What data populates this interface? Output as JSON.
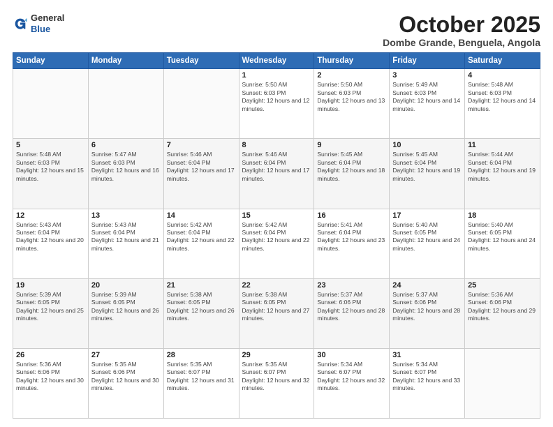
{
  "header": {
    "logo": {
      "line1": "General",
      "line2": "Blue"
    },
    "title": "October 2025",
    "subtitle": "Dombe Grande, Benguela, Angola"
  },
  "weekdays": [
    "Sunday",
    "Monday",
    "Tuesday",
    "Wednesday",
    "Thursday",
    "Friday",
    "Saturday"
  ],
  "weeks": [
    [
      {
        "day": "",
        "sunrise": "",
        "sunset": "",
        "daylight": ""
      },
      {
        "day": "",
        "sunrise": "",
        "sunset": "",
        "daylight": ""
      },
      {
        "day": "",
        "sunrise": "",
        "sunset": "",
        "daylight": ""
      },
      {
        "day": "1",
        "sunrise": "Sunrise: 5:50 AM",
        "sunset": "Sunset: 6:03 PM",
        "daylight": "Daylight: 12 hours and 12 minutes."
      },
      {
        "day": "2",
        "sunrise": "Sunrise: 5:50 AM",
        "sunset": "Sunset: 6:03 PM",
        "daylight": "Daylight: 12 hours and 13 minutes."
      },
      {
        "day": "3",
        "sunrise": "Sunrise: 5:49 AM",
        "sunset": "Sunset: 6:03 PM",
        "daylight": "Daylight: 12 hours and 14 minutes."
      },
      {
        "day": "4",
        "sunrise": "Sunrise: 5:48 AM",
        "sunset": "Sunset: 6:03 PM",
        "daylight": "Daylight: 12 hours and 14 minutes."
      }
    ],
    [
      {
        "day": "5",
        "sunrise": "Sunrise: 5:48 AM",
        "sunset": "Sunset: 6:03 PM",
        "daylight": "Daylight: 12 hours and 15 minutes."
      },
      {
        "day": "6",
        "sunrise": "Sunrise: 5:47 AM",
        "sunset": "Sunset: 6:03 PM",
        "daylight": "Daylight: 12 hours and 16 minutes."
      },
      {
        "day": "7",
        "sunrise": "Sunrise: 5:46 AM",
        "sunset": "Sunset: 6:04 PM",
        "daylight": "Daylight: 12 hours and 17 minutes."
      },
      {
        "day": "8",
        "sunrise": "Sunrise: 5:46 AM",
        "sunset": "Sunset: 6:04 PM",
        "daylight": "Daylight: 12 hours and 17 minutes."
      },
      {
        "day": "9",
        "sunrise": "Sunrise: 5:45 AM",
        "sunset": "Sunset: 6:04 PM",
        "daylight": "Daylight: 12 hours and 18 minutes."
      },
      {
        "day": "10",
        "sunrise": "Sunrise: 5:45 AM",
        "sunset": "Sunset: 6:04 PM",
        "daylight": "Daylight: 12 hours and 19 minutes."
      },
      {
        "day": "11",
        "sunrise": "Sunrise: 5:44 AM",
        "sunset": "Sunset: 6:04 PM",
        "daylight": "Daylight: 12 hours and 19 minutes."
      }
    ],
    [
      {
        "day": "12",
        "sunrise": "Sunrise: 5:43 AM",
        "sunset": "Sunset: 6:04 PM",
        "daylight": "Daylight: 12 hours and 20 minutes."
      },
      {
        "day": "13",
        "sunrise": "Sunrise: 5:43 AM",
        "sunset": "Sunset: 6:04 PM",
        "daylight": "Daylight: 12 hours and 21 minutes."
      },
      {
        "day": "14",
        "sunrise": "Sunrise: 5:42 AM",
        "sunset": "Sunset: 6:04 PM",
        "daylight": "Daylight: 12 hours and 22 minutes."
      },
      {
        "day": "15",
        "sunrise": "Sunrise: 5:42 AM",
        "sunset": "Sunset: 6:04 PM",
        "daylight": "Daylight: 12 hours and 22 minutes."
      },
      {
        "day": "16",
        "sunrise": "Sunrise: 5:41 AM",
        "sunset": "Sunset: 6:04 PM",
        "daylight": "Daylight: 12 hours and 23 minutes."
      },
      {
        "day": "17",
        "sunrise": "Sunrise: 5:40 AM",
        "sunset": "Sunset: 6:05 PM",
        "daylight": "Daylight: 12 hours and 24 minutes."
      },
      {
        "day": "18",
        "sunrise": "Sunrise: 5:40 AM",
        "sunset": "Sunset: 6:05 PM",
        "daylight": "Daylight: 12 hours and 24 minutes."
      }
    ],
    [
      {
        "day": "19",
        "sunrise": "Sunrise: 5:39 AM",
        "sunset": "Sunset: 6:05 PM",
        "daylight": "Daylight: 12 hours and 25 minutes."
      },
      {
        "day": "20",
        "sunrise": "Sunrise: 5:39 AM",
        "sunset": "Sunset: 6:05 PM",
        "daylight": "Daylight: 12 hours and 26 minutes."
      },
      {
        "day": "21",
        "sunrise": "Sunrise: 5:38 AM",
        "sunset": "Sunset: 6:05 PM",
        "daylight": "Daylight: 12 hours and 26 minutes."
      },
      {
        "day": "22",
        "sunrise": "Sunrise: 5:38 AM",
        "sunset": "Sunset: 6:05 PM",
        "daylight": "Daylight: 12 hours and 27 minutes."
      },
      {
        "day": "23",
        "sunrise": "Sunrise: 5:37 AM",
        "sunset": "Sunset: 6:06 PM",
        "daylight": "Daylight: 12 hours and 28 minutes."
      },
      {
        "day": "24",
        "sunrise": "Sunrise: 5:37 AM",
        "sunset": "Sunset: 6:06 PM",
        "daylight": "Daylight: 12 hours and 28 minutes."
      },
      {
        "day": "25",
        "sunrise": "Sunrise: 5:36 AM",
        "sunset": "Sunset: 6:06 PM",
        "daylight": "Daylight: 12 hours and 29 minutes."
      }
    ],
    [
      {
        "day": "26",
        "sunrise": "Sunrise: 5:36 AM",
        "sunset": "Sunset: 6:06 PM",
        "daylight": "Daylight: 12 hours and 30 minutes."
      },
      {
        "day": "27",
        "sunrise": "Sunrise: 5:35 AM",
        "sunset": "Sunset: 6:06 PM",
        "daylight": "Daylight: 12 hours and 30 minutes."
      },
      {
        "day": "28",
        "sunrise": "Sunrise: 5:35 AM",
        "sunset": "Sunset: 6:07 PM",
        "daylight": "Daylight: 12 hours and 31 minutes."
      },
      {
        "day": "29",
        "sunrise": "Sunrise: 5:35 AM",
        "sunset": "Sunset: 6:07 PM",
        "daylight": "Daylight: 12 hours and 32 minutes."
      },
      {
        "day": "30",
        "sunrise": "Sunrise: 5:34 AM",
        "sunset": "Sunset: 6:07 PM",
        "daylight": "Daylight: 12 hours and 32 minutes."
      },
      {
        "day": "31",
        "sunrise": "Sunrise: 5:34 AM",
        "sunset": "Sunset: 6:07 PM",
        "daylight": "Daylight: 12 hours and 33 minutes."
      },
      {
        "day": "",
        "sunrise": "",
        "sunset": "",
        "daylight": ""
      }
    ]
  ]
}
